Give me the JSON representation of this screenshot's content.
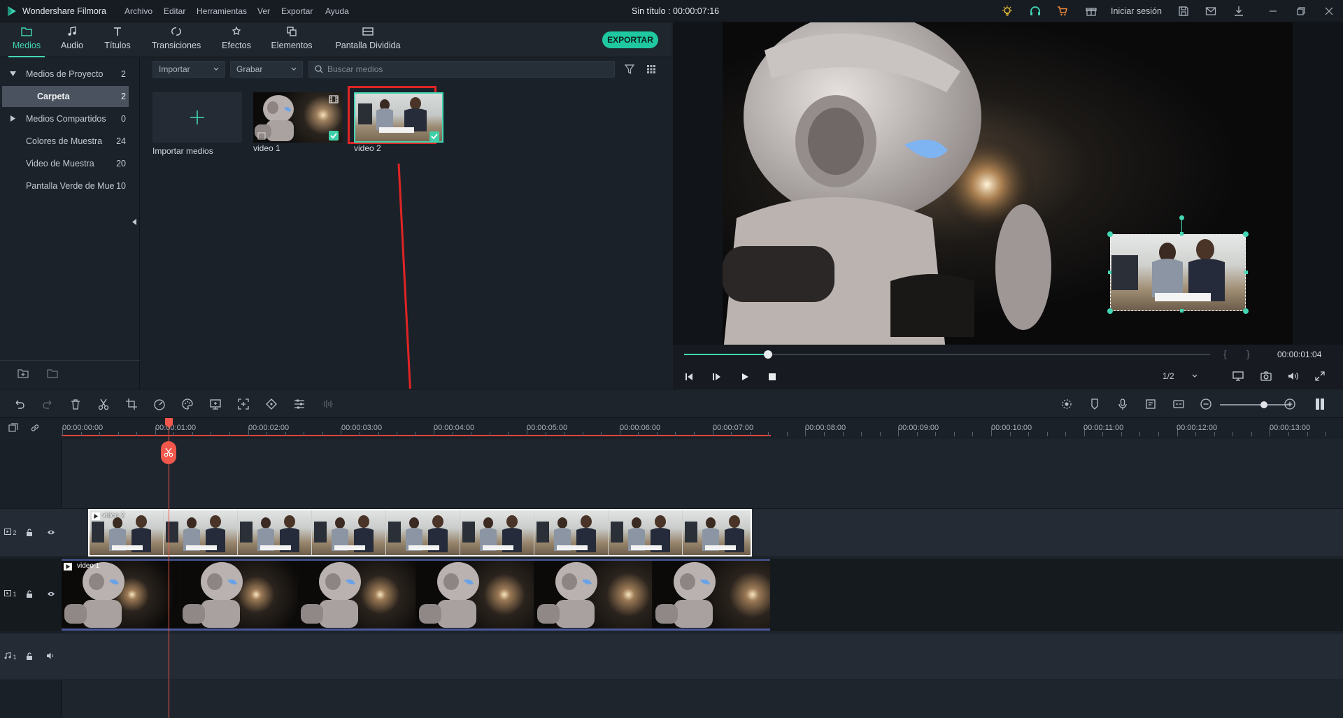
{
  "app": {
    "name": "Wondershare Filmora",
    "title": "Sin título : 00:00:07:16",
    "sign_in": "Iniciar sesión"
  },
  "menu": [
    "Archivo",
    "Editar",
    "Herramientas",
    "Ver",
    "Exportar",
    "Ayuda"
  ],
  "tabs": [
    {
      "label": "Medios",
      "icon": "folder-icon",
      "active": true
    },
    {
      "label": "Audio",
      "icon": "music-note-icon"
    },
    {
      "label": "Títulos",
      "icon": "text-icon"
    },
    {
      "label": "Transiciones",
      "icon": "transition-icon"
    },
    {
      "label": "Efectos",
      "icon": "effects-icon"
    },
    {
      "label": "Elementos",
      "icon": "elements-icon"
    },
    {
      "label": "Pantalla Dividida",
      "icon": "split-screen-icon"
    }
  ],
  "export_label": "EXPORTAR",
  "sidebar": {
    "items": [
      {
        "label": "Medios de Proyecto",
        "count": "2",
        "expanded": true
      },
      {
        "label": "Carpeta",
        "count": "2",
        "selected": true
      },
      {
        "label": "Medios Compartidos",
        "count": "0",
        "collapsed": true
      },
      {
        "label": "Colores de Muestra",
        "count": "24"
      },
      {
        "label": "Video de Muestra",
        "count": "20"
      },
      {
        "label": "Pantalla Verde de Mue",
        "count": "10"
      }
    ]
  },
  "media_toolbar": {
    "import": "Importar",
    "record": "Grabar",
    "search_placeholder": "Buscar medios"
  },
  "media_items": [
    {
      "label": "Importar medios"
    },
    {
      "label": "video 1"
    },
    {
      "label": "video 2"
    }
  ],
  "player": {
    "time": "00:00:01:04",
    "quality": "1/2",
    "progress": 0.16
  },
  "ruler_ticks": [
    "00:00:00:00",
    "00:00:01:00",
    "00:00:02:00",
    "00:00:03:00",
    "00:00:04:00",
    "00:00:05:00",
    "00:00:06:00",
    "00:00:07:00",
    "00:00:08:00",
    "00:00:09:00",
    "00:00:10:00",
    "00:00:11:00",
    "00:00:12:00",
    "00:00:13:00"
  ],
  "tracks": {
    "video2_label": "video 2",
    "video1_label": "video 1",
    "v2": "2",
    "v1": "1",
    "a1": "1"
  },
  "colors": {
    "accent": "#43d6b4",
    "playhead": "#f2574c",
    "highlight": "#e02424"
  }
}
